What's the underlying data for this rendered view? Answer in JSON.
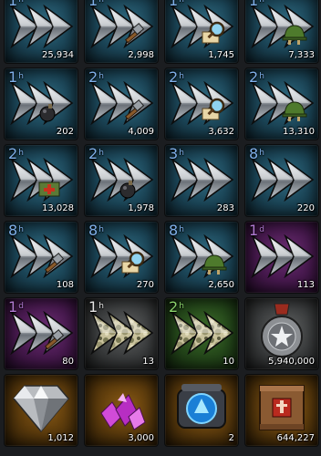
{
  "items": [
    {
      "duration": "1",
      "unit": "h",
      "quantity": "25,934",
      "bg": "blue",
      "icon": "speedup",
      "overlay": "none"
    },
    {
      "duration": "1",
      "unit": "h",
      "quantity": "2,998",
      "bg": "blue",
      "icon": "speedup",
      "overlay": "hammer"
    },
    {
      "duration": "1",
      "unit": "h",
      "quantity": "1,745",
      "bg": "blue",
      "icon": "speedup",
      "overlay": "magnifier"
    },
    {
      "duration": "1",
      "unit": "h",
      "quantity": "7,333",
      "bg": "blue",
      "icon": "speedup",
      "overlay": "helmet"
    },
    {
      "duration": "1",
      "unit": "h",
      "quantity": "202",
      "bg": "blue",
      "icon": "speedup",
      "overlay": "bomb"
    },
    {
      "duration": "2",
      "unit": "h",
      "quantity": "4,009",
      "bg": "blue",
      "icon": "speedup",
      "overlay": "hammer"
    },
    {
      "duration": "2",
      "unit": "h",
      "quantity": "3,632",
      "bg": "blue",
      "icon": "speedup",
      "overlay": "magnifier"
    },
    {
      "duration": "2",
      "unit": "h",
      "quantity": "13,310",
      "bg": "blue",
      "icon": "speedup",
      "overlay": "helmet"
    },
    {
      "duration": "2",
      "unit": "h",
      "quantity": "13,028",
      "bg": "blue",
      "icon": "speedup",
      "overlay": "medkit"
    },
    {
      "duration": "2",
      "unit": "h",
      "quantity": "1,978",
      "bg": "blue",
      "icon": "speedup",
      "overlay": "bomb"
    },
    {
      "duration": "3",
      "unit": "h",
      "quantity": "283",
      "bg": "blue",
      "icon": "speedup",
      "overlay": "none"
    },
    {
      "duration": "8",
      "unit": "h",
      "quantity": "220",
      "bg": "blue",
      "icon": "speedup",
      "overlay": "none"
    },
    {
      "duration": "8",
      "unit": "h",
      "quantity": "108",
      "bg": "blue",
      "icon": "speedup",
      "overlay": "hammer"
    },
    {
      "duration": "8",
      "unit": "h",
      "quantity": "270",
      "bg": "blue",
      "icon": "speedup",
      "overlay": "magnifier"
    },
    {
      "duration": "8",
      "unit": "h",
      "quantity": "2,650",
      "bg": "blue",
      "icon": "speedup",
      "overlay": "helmet"
    },
    {
      "duration": "1",
      "unit": "d",
      "quantity": "113",
      "bg": "purple",
      "icon": "speedup",
      "overlay": "none"
    },
    {
      "duration": "1",
      "unit": "d",
      "quantity": "80",
      "bg": "purple",
      "icon": "speedup",
      "overlay": "hammer"
    },
    {
      "duration": "1",
      "unit": "h",
      "quantity": "13",
      "bg": "grey",
      "icon": "camo-speedup",
      "overlay": "none"
    },
    {
      "duration": "2",
      "unit": "h",
      "quantity": "10",
      "bg": "green",
      "icon": "camo-speedup",
      "overlay": "none"
    },
    {
      "duration": "",
      "unit": "",
      "quantity": "5,940,000",
      "bg": "grey",
      "icon": "medal",
      "overlay": "none"
    },
    {
      "duration": "",
      "unit": "",
      "quantity": "1,012",
      "bg": "orange",
      "icon": "diamond",
      "overlay": "none"
    },
    {
      "duration": "",
      "unit": "",
      "quantity": "3,000",
      "bg": "orange",
      "icon": "crystals",
      "overlay": "none"
    },
    {
      "duration": "",
      "unit": "",
      "quantity": "2",
      "bg": "orange",
      "icon": "device",
      "overlay": "none"
    },
    {
      "duration": "",
      "unit": "",
      "quantity": "644,227",
      "bg": "orange",
      "icon": "crate",
      "overlay": "none"
    }
  ]
}
